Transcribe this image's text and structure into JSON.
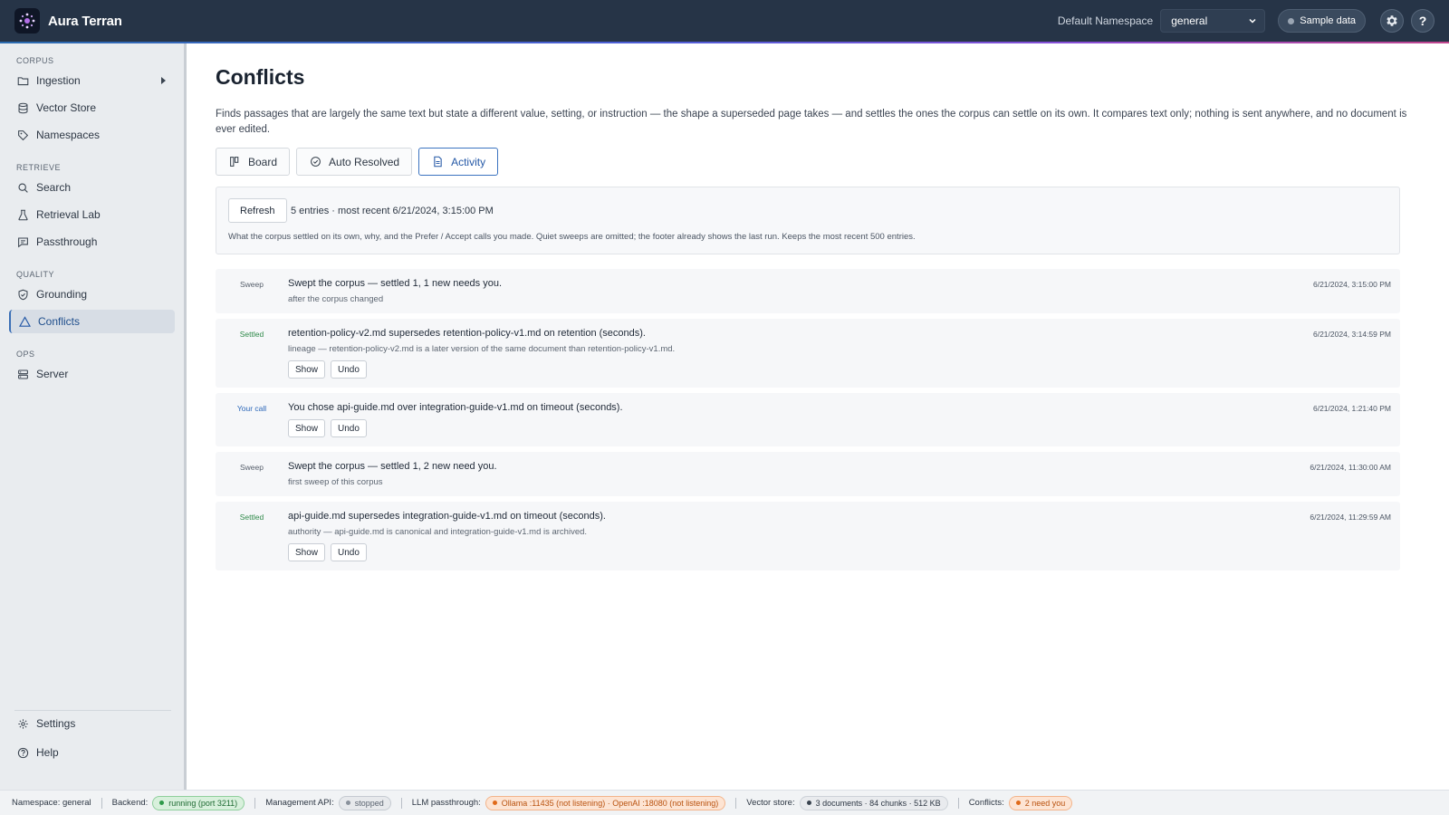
{
  "app": {
    "name": "Aura Terran"
  },
  "header": {
    "namespace_label": "Default Namespace",
    "namespace_value": "general",
    "sample_data_label": "Sample data",
    "settings_icon": "gear-icon",
    "help_icon": "question-icon"
  },
  "sidebar": {
    "sections": [
      {
        "label": "CORPUS",
        "items": [
          {
            "label": "Ingestion",
            "icon": "folder-icon",
            "expandable": true
          },
          {
            "label": "Vector Store",
            "icon": "database-icon"
          },
          {
            "label": "Namespaces",
            "icon": "tag-icon"
          }
        ]
      },
      {
        "label": "RETRIEVE",
        "items": [
          {
            "label": "Search",
            "icon": "search-icon"
          },
          {
            "label": "Retrieval Lab",
            "icon": "flask-icon"
          },
          {
            "label": "Passthrough",
            "icon": "chat-icon"
          }
        ]
      },
      {
        "label": "QUALITY",
        "items": [
          {
            "label": "Grounding",
            "icon": "shield-check-icon"
          },
          {
            "label": "Conflicts",
            "icon": "warning-triangle-icon",
            "active": true
          }
        ]
      },
      {
        "label": "OPS",
        "items": [
          {
            "label": "Server",
            "icon": "server-icon"
          }
        ]
      }
    ],
    "bottom": [
      {
        "label": "Settings",
        "icon": "gear-icon"
      },
      {
        "label": "Help",
        "icon": "question-icon"
      }
    ]
  },
  "main": {
    "title": "Conflicts",
    "description": "Finds passages that are largely the same text but state a different value, setting, or instruction — the shape a superseded page takes — and settles the ones the corpus can settle on its own. It compares text only; nothing is sent anywhere, and no document is ever edited.",
    "tabs": [
      {
        "label": "Board",
        "icon": "board-icon"
      },
      {
        "label": "Auto Resolved",
        "icon": "check-circle-icon"
      },
      {
        "label": "Activity",
        "icon": "document-icon",
        "active": true
      }
    ],
    "panel": {
      "refresh_label": "Refresh",
      "entries_info": "5 entries · most recent 6/21/2024, 3:15:00 PM",
      "note": "What the corpus settled on its own, why, and the Prefer / Accept calls you made. Quiet sweeps are omitted; the footer already shows the last run. Keeps the most recent 500 entries."
    },
    "entries": [
      {
        "kind": "Sweep",
        "title": "Swept the corpus — settled 1, 1 new needs you.",
        "sub": "after the corpus changed",
        "time": "6/21/2024, 3:15:00 PM",
        "actions": []
      },
      {
        "kind": "Settled",
        "title": "retention-policy-v2.md supersedes retention-policy-v1.md on retention (seconds).",
        "sub": "lineage — retention-policy-v2.md is a later version of the same document than retention-policy-v1.md.",
        "time": "6/21/2024, 3:14:59 PM",
        "actions": [
          "Show",
          "Undo"
        ]
      },
      {
        "kind": "Your call",
        "title": "You chose api-guide.md over integration-guide-v1.md on timeout (seconds).",
        "sub": "",
        "time": "6/21/2024, 1:21:40 PM",
        "actions": [
          "Show",
          "Undo"
        ]
      },
      {
        "kind": "Sweep",
        "title": "Swept the corpus — settled 1, 2 new need you.",
        "sub": "first sweep of this corpus",
        "time": "6/21/2024, 11:30:00 AM",
        "actions": []
      },
      {
        "kind": "Settled",
        "title": "api-guide.md supersedes integration-guide-v1.md on timeout (seconds).",
        "sub": "authority — api-guide.md is canonical and integration-guide-v1.md is archived.",
        "time": "6/21/2024, 11:29:59 AM",
        "actions": [
          "Show",
          "Undo"
        ]
      }
    ]
  },
  "footer": {
    "namespace": "Namespace: general",
    "backend_label": "Backend:",
    "backend_status": "running (port 3211)",
    "mgmt_label": "Management API:",
    "mgmt_status": "stopped",
    "llm_label": "LLM passthrough:",
    "llm_status": "Ollama :11435 (not listening) · OpenAI :18080 (not listening)",
    "vector_label": "Vector store:",
    "vector_status": "3 documents · 84 chunks · 512 KB",
    "conflicts_label": "Conflicts:",
    "conflicts_status": "2 need you"
  },
  "colors": {
    "header_bg": "#263447",
    "accent": "#3b73c0",
    "settled": "#2f8a4a",
    "your_call": "#2a66b8",
    "warning": "#e06a1a"
  }
}
